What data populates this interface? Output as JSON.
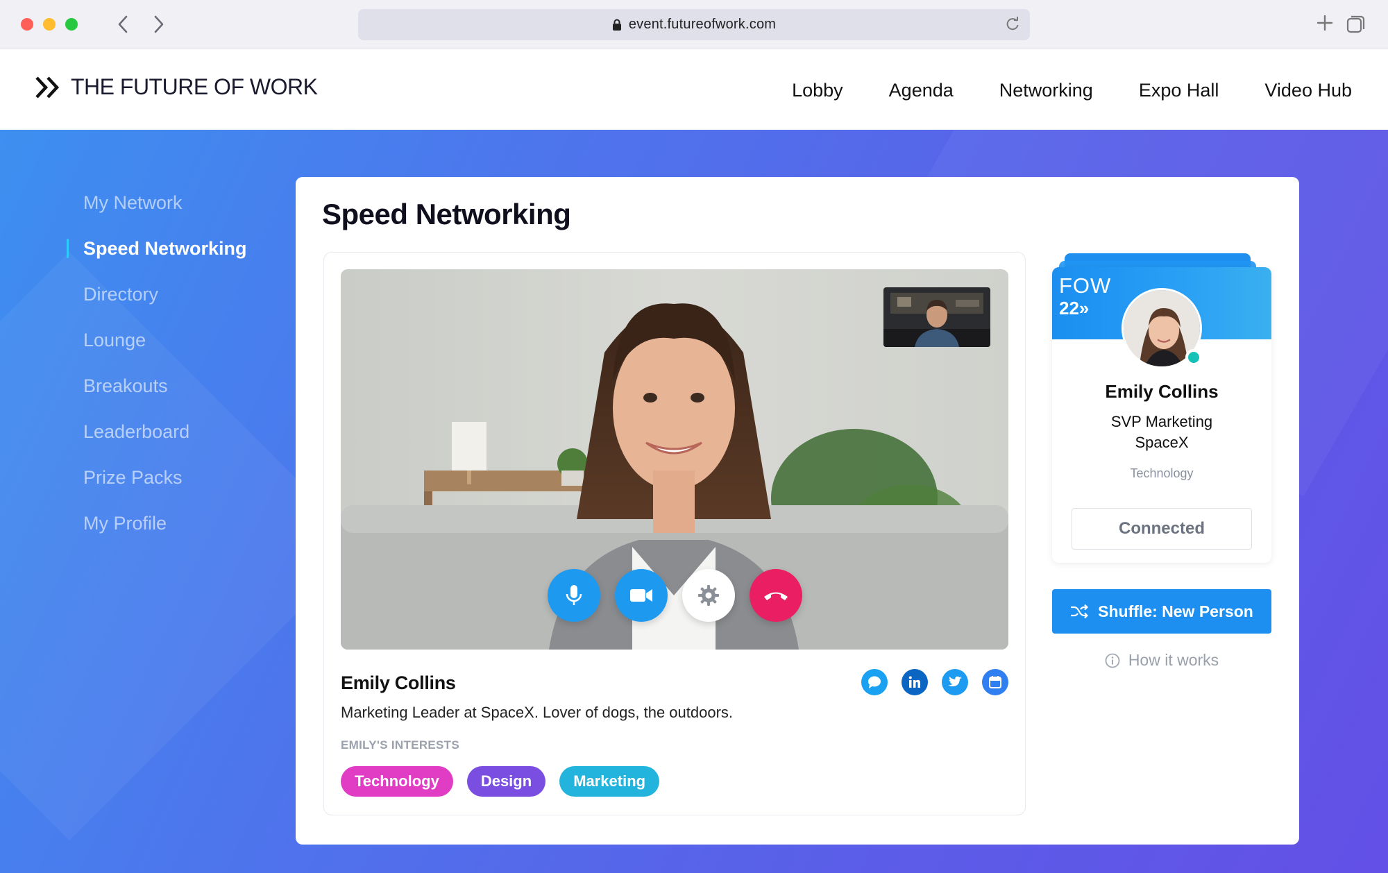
{
  "browser": {
    "url": "event.futureofwork.com"
  },
  "header": {
    "logo_text": "THE FUTURE OF WORK",
    "nav": [
      "Lobby",
      "Agenda",
      "Networking",
      "Expo Hall",
      "Video Hub"
    ]
  },
  "sidebar": {
    "items": [
      {
        "label": "My Network",
        "active": false
      },
      {
        "label": "Speed Networking",
        "active": true
      },
      {
        "label": "Directory",
        "active": false
      },
      {
        "label": "Lounge",
        "active": false
      },
      {
        "label": "Breakouts",
        "active": false
      },
      {
        "label": "Leaderboard",
        "active": false
      },
      {
        "label": "Prize Packs",
        "active": false
      },
      {
        "label": "My Profile",
        "active": false
      }
    ]
  },
  "main": {
    "title": "Speed Networking",
    "call": {
      "person_name": "Emily Collins",
      "bio": "Marketing Leader at SpaceX. Lover of dogs, the outdoors.",
      "interests_label": "EMILY'S INTERESTS",
      "interests": [
        "Technology",
        "Design",
        "Marketing"
      ],
      "controls": [
        "microphone-icon",
        "video-camera-icon",
        "gear-icon",
        "hang-up-icon"
      ],
      "social": [
        "chat-icon",
        "linkedin-icon",
        "twitter-icon",
        "calendar-icon"
      ]
    },
    "profile_card": {
      "badge_line1": "FOW",
      "badge_line2": "22»",
      "name": "Emily Collins",
      "title": "SVP Marketing",
      "company": "SpaceX",
      "interest": "Technology",
      "status_button": "Connected"
    },
    "shuffle_button": "Shuffle: New Person",
    "how_it_works": "How it works"
  },
  "colors": {
    "accent": "#1c8ff0",
    "hangup": "#ea1e63",
    "tag_technology": "#e03dc4",
    "tag_design": "#7b4ee2",
    "tag_marketing": "#22b4dd",
    "online": "#16c2b8"
  }
}
